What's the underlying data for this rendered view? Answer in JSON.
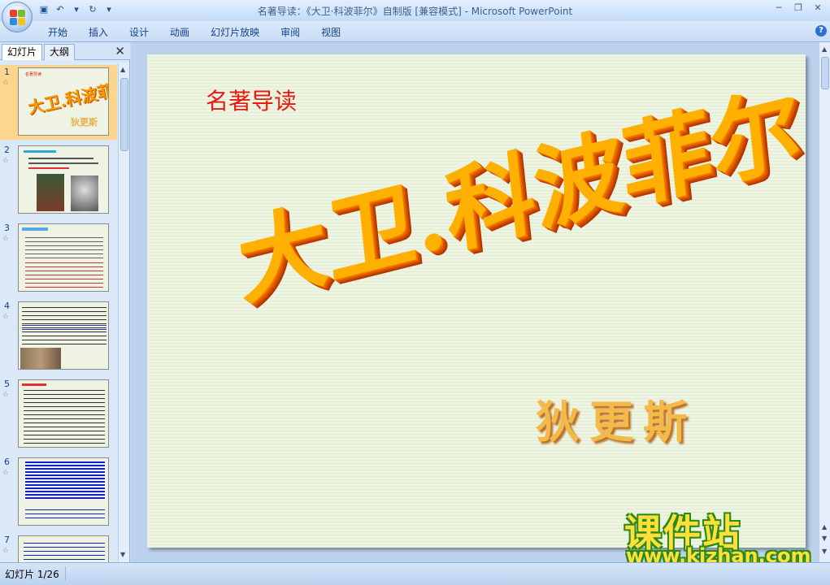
{
  "window": {
    "title": "名著导读：《大卫·科波菲尔》自制版 [兼容模式] - Microsoft PowerPoint"
  },
  "quick_access": [
    {
      "icon": "save-icon",
      "glyph": "▣"
    },
    {
      "icon": "undo-icon",
      "glyph": "↶"
    },
    {
      "icon": "dropdown-icon",
      "glyph": "▾"
    },
    {
      "icon": "redo-icon",
      "glyph": "↻"
    },
    {
      "icon": "customize-icon",
      "glyph": "▾"
    }
  ],
  "ribbon": {
    "tabs": [
      "开始",
      "插入",
      "设计",
      "动画",
      "幻灯片放映",
      "审阅",
      "视图"
    ]
  },
  "left_panel": {
    "tab_slides": "幻灯片",
    "tab_outline": "大纲",
    "close": "✕",
    "thumbnails": [
      {
        "num": "1",
        "star": "☆",
        "selected": true
      },
      {
        "num": "2",
        "star": "☆",
        "selected": false
      },
      {
        "num": "3",
        "star": "☆",
        "selected": false
      },
      {
        "num": "4",
        "star": "☆",
        "selected": false
      },
      {
        "num": "5",
        "star": "☆",
        "selected": false
      },
      {
        "num": "6",
        "star": "☆",
        "selected": false
      },
      {
        "num": "7",
        "star": "☆",
        "selected": false
      }
    ]
  },
  "slide": {
    "subtitle": "名著导读",
    "title": "大卫.科波菲尔",
    "author": "狄更斯"
  },
  "watermark": {
    "text": "课件站",
    "url": "www.kjzhan.com"
  },
  "status": {
    "slide_count": "幻灯片 1/26"
  },
  "colors": {
    "title_orange": "#ffb000",
    "subtitle_red": "#e8190e",
    "selected_thumb": "#fbd68c"
  }
}
